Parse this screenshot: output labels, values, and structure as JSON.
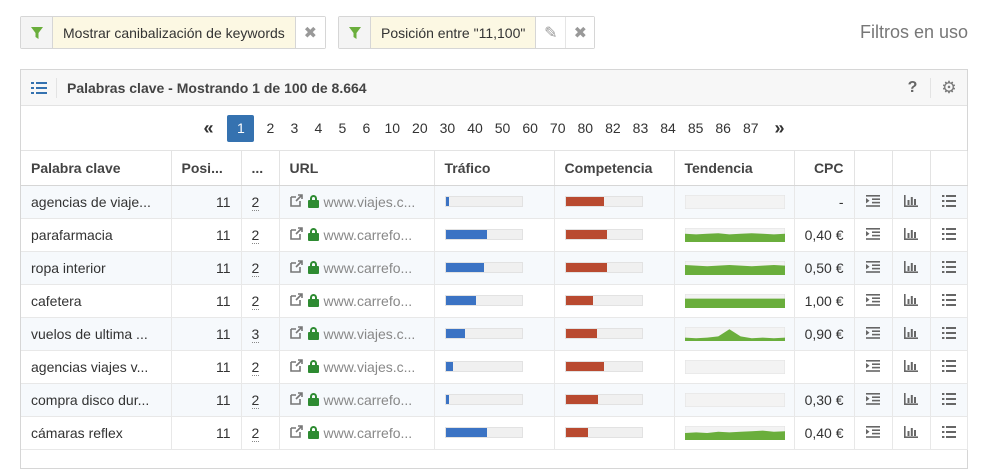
{
  "filters": [
    {
      "label": "Mostrar canibalización de keywords",
      "actions": [
        "close"
      ]
    },
    {
      "label": "Posición entre \"11,100\"",
      "actions": [
        "edit",
        "close"
      ]
    }
  ],
  "filters_title": "Filtros en uso",
  "panel": {
    "title": "Palabras clave - Mostrando 1 de 100 de 8.664",
    "help": "?"
  },
  "pagination": {
    "prev": "«",
    "next": "»",
    "current": "1",
    "pages": [
      "1",
      "2",
      "3",
      "4",
      "5",
      "6",
      "10",
      "20",
      "30",
      "40",
      "50",
      "60",
      "70",
      "80",
      "82",
      "83",
      "84",
      "85",
      "86",
      "87"
    ]
  },
  "columns": [
    "Palabra clave",
    "Posi...",
    "...",
    "URL",
    "Tráfico",
    "Competencia",
    "Tendencia",
    "CPC"
  ],
  "colors": {
    "accent": "#3572b0",
    "traffic": "#3b73c4",
    "competition": "#b94a30",
    "trend": "#6aae3c",
    "lock": "#2e8b32",
    "filter": "#6aae3c"
  },
  "rows": [
    {
      "keyword": "agencias de viaje...",
      "position": "11",
      "count": "2",
      "url": "www.viajes.c...",
      "traffic": 0.04,
      "competition": 0.5,
      "trend": [
        0,
        0,
        0,
        0,
        0,
        0,
        0,
        0,
        0,
        0
      ],
      "cpc": "-"
    },
    {
      "keyword": "parafarmacia",
      "position": "11",
      "count": "2",
      "url": "www.carrefo...",
      "traffic": 0.55,
      "competition": 0.55,
      "trend": [
        0.6,
        0.55,
        0.6,
        0.65,
        0.55,
        0.6,
        0.65,
        0.6,
        0.55,
        0.6
      ],
      "cpc": "0,40 €"
    },
    {
      "keyword": "ropa interior",
      "position": "11",
      "count": "2",
      "url": "www.carrefo...",
      "traffic": 0.5,
      "competition": 0.55,
      "trend": [
        0.75,
        0.7,
        0.65,
        0.7,
        0.75,
        0.7,
        0.65,
        0.7,
        0.75,
        0.7
      ],
      "cpc": "0,50 €"
    },
    {
      "keyword": "cafetera",
      "position": "11",
      "count": "2",
      "url": "www.carrefo...",
      "traffic": 0.4,
      "competition": 0.36,
      "trend": [
        0.7,
        0.7,
        0.7,
        0.7,
        0.7,
        0.7,
        0.7,
        0.7,
        0.7,
        0.7
      ],
      "cpc": "1,00 €"
    },
    {
      "keyword": "vuelos de ultima ...",
      "position": "11",
      "count": "3",
      "url": "www.viajes.c...",
      "traffic": 0.25,
      "competition": 0.42,
      "trend": [
        0.2,
        0.15,
        0.2,
        0.3,
        0.9,
        0.3,
        0.15,
        0.2,
        0.15,
        0.2
      ],
      "cpc": "0,90 €"
    },
    {
      "keyword": "agencias viajes v...",
      "position": "11",
      "count": "2",
      "url": "www.viajes.c...",
      "traffic": 0.1,
      "competition": 0.5,
      "trend": [
        0,
        0,
        0,
        0,
        0,
        0,
        0,
        0,
        0,
        0
      ],
      "cpc": ""
    },
    {
      "keyword": "compra disco dur...",
      "position": "11",
      "count": "2",
      "url": "www.carrefo...",
      "traffic": 0.04,
      "competition": 0.43,
      "trend": [
        0,
        0,
        0,
        0,
        0,
        0,
        0,
        0,
        0,
        0
      ],
      "cpc": "0,30 €"
    },
    {
      "keyword": "cámaras reflex",
      "position": "11",
      "count": "2",
      "url": "www.carrefo...",
      "traffic": 0.55,
      "competition": 0.3,
      "trend": [
        0.5,
        0.55,
        0.5,
        0.6,
        0.55,
        0.6,
        0.65,
        0.7,
        0.6,
        0.65
      ],
      "cpc": "0,40 €"
    }
  ]
}
